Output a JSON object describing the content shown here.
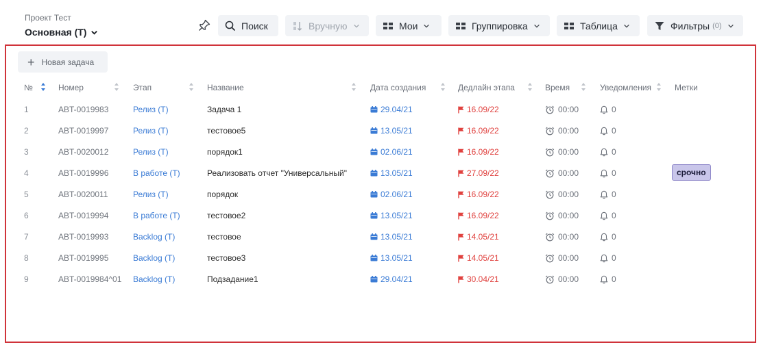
{
  "header": {
    "project_label": "Проект Тест",
    "board_name": "Основная (Т)",
    "search_label": "Поиск",
    "sort_label": "Вручную",
    "mine_label": "Мои",
    "group_label": "Группировка",
    "view_label": "Таблица",
    "filters_label": "Фильтры",
    "filters_count": "(0)"
  },
  "toolbar": {
    "new_task_label": "Новая задача"
  },
  "table": {
    "columns": {
      "num": "№",
      "code": "Номер",
      "stage": "Этап",
      "name": "Название",
      "created": "Дата создания",
      "deadline": "Дедлайн этапа",
      "time": "Время",
      "notifications": "Уведомления",
      "tags": "Метки"
    },
    "rows": [
      {
        "num": "1",
        "code": "ABT-0019983",
        "stage": "Релиз (Т)",
        "name": "Задача 1",
        "created": "29.04/21",
        "deadline": "16.09/22",
        "time": "00:00",
        "notifications": "0",
        "tag": ""
      },
      {
        "num": "2",
        "code": "ABT-0019997",
        "stage": "Релиз (Т)",
        "name": "тестовое5",
        "created": "13.05/21",
        "deadline": "16.09/22",
        "time": "00:00",
        "notifications": "0",
        "tag": ""
      },
      {
        "num": "3",
        "code": "ABT-0020012",
        "stage": "Релиз (Т)",
        "name": "порядок1",
        "created": "02.06/21",
        "deadline": "16.09/22",
        "time": "00:00",
        "notifications": "0",
        "tag": ""
      },
      {
        "num": "4",
        "code": "ABT-0019996",
        "stage": "В работе (Т)",
        "name": "Реализовать отчет \"Универсальный\"",
        "created": "13.05/21",
        "deadline": "27.09/22",
        "time": "00:00",
        "notifications": "0",
        "tag": "срочно"
      },
      {
        "num": "5",
        "code": "ABT-0020011",
        "stage": "Релиз (Т)",
        "name": "порядок",
        "created": "02.06/21",
        "deadline": "16.09/22",
        "time": "00:00",
        "notifications": "0",
        "tag": ""
      },
      {
        "num": "6",
        "code": "ABT-0019994",
        "stage": "В работе (Т)",
        "name": "тестовое2",
        "created": "13.05/21",
        "deadline": "16.09/22",
        "time": "00:00",
        "notifications": "0",
        "tag": ""
      },
      {
        "num": "7",
        "code": "ABT-0019993",
        "stage": "Backlog (Т)",
        "name": "тестовое",
        "created": "13.05/21",
        "deadline": "14.05/21",
        "time": "00:00",
        "notifications": "0",
        "tag": ""
      },
      {
        "num": "8",
        "code": "ABT-0019995",
        "stage": "Backlog (Т)",
        "name": "тестовое3",
        "created": "13.05/21",
        "deadline": "14.05/21",
        "time": "00:00",
        "notifications": "0",
        "tag": ""
      },
      {
        "num": "9",
        "code": "ABT-0019984^01",
        "stage": "Backlog (Т)",
        "name": "Подзадание1",
        "created": "29.04/21",
        "deadline": "30.04/21",
        "time": "00:00",
        "notifications": "0",
        "tag": ""
      }
    ]
  },
  "icons": {
    "pin": "pin-icon",
    "search": "search-icon",
    "sort": "sort-icon",
    "mine": "cards-icon",
    "group": "cards-icon",
    "view": "cards-icon",
    "filter": "filter-icon",
    "calendar": "calendar-icon",
    "flag": "flag-icon",
    "clock": "alarm-clock-icon",
    "bell": "bell-icon"
  },
  "colors": {
    "stage_link": "#3a7bd5",
    "deadline": "#e0413e",
    "frame": "#d0333a",
    "tag_bg": "#c9c6ea"
  }
}
